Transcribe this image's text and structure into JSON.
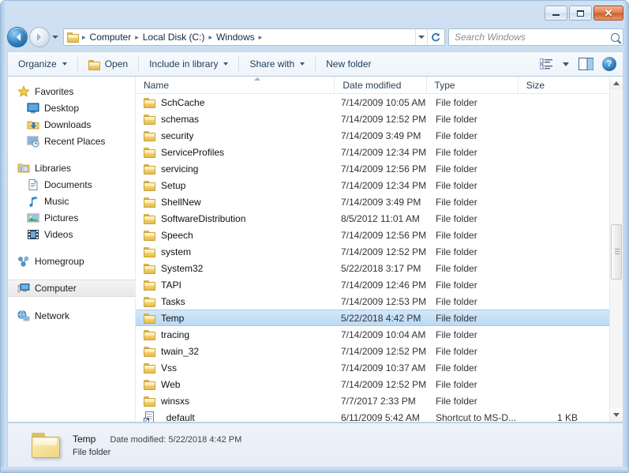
{
  "window": {
    "minimize_label": "Minimize",
    "maximize_label": "Maximize",
    "close_label": "Close"
  },
  "navigation": {
    "back_label": "Back",
    "forward_label": "Forward",
    "history_label": "Recent pages",
    "refresh_label": "Refresh",
    "breadcrumbs": [
      "Computer",
      "Local Disk (C:)",
      "Windows"
    ],
    "separator": "▸"
  },
  "search": {
    "placeholder": "Search Windows"
  },
  "toolbar": {
    "organize_label": "Organize",
    "open_label": "Open",
    "include_label": "Include in library",
    "share_label": "Share with",
    "newfolder_label": "New folder",
    "views_label": "Change your view",
    "preview_label": "Show the preview pane",
    "help_label": "?"
  },
  "sidebar": {
    "groups": [
      {
        "header": "Favorites",
        "icon": "star-icon",
        "items": [
          {
            "label": "Desktop",
            "icon": "desktop-icon"
          },
          {
            "label": "Downloads",
            "icon": "downloads-icon"
          },
          {
            "label": "Recent Places",
            "icon": "recent-places-icon"
          }
        ]
      },
      {
        "header": "Libraries",
        "icon": "libraries-icon",
        "items": [
          {
            "label": "Documents",
            "icon": "documents-icon"
          },
          {
            "label": "Music",
            "icon": "music-icon"
          },
          {
            "label": "Pictures",
            "icon": "pictures-icon"
          },
          {
            "label": "Videos",
            "icon": "videos-icon"
          }
        ]
      },
      {
        "header": "Homegroup",
        "icon": "homegroup-icon",
        "items": []
      },
      {
        "header": "Computer",
        "icon": "computer-icon",
        "items": [],
        "selected": true
      },
      {
        "header": "Network",
        "icon": "network-icon",
        "items": []
      }
    ]
  },
  "filelist": {
    "columns": [
      "Name",
      "Date modified",
      "Type",
      "Size"
    ],
    "sorted_column": "Name",
    "rows": [
      {
        "name": "SchCache",
        "date": "7/14/2009 10:05 AM",
        "type": "File folder",
        "size": "",
        "icon": "folder-icon"
      },
      {
        "name": "schemas",
        "date": "7/14/2009 12:52 PM",
        "type": "File folder",
        "size": "",
        "icon": "folder-icon"
      },
      {
        "name": "security",
        "date": "7/14/2009 3:49 PM",
        "type": "File folder",
        "size": "",
        "icon": "folder-icon"
      },
      {
        "name": "ServiceProfiles",
        "date": "7/14/2009 12:34 PM",
        "type": "File folder",
        "size": "",
        "icon": "folder-icon"
      },
      {
        "name": "servicing",
        "date": "7/14/2009 12:56 PM",
        "type": "File folder",
        "size": "",
        "icon": "folder-icon"
      },
      {
        "name": "Setup",
        "date": "7/14/2009 12:34 PM",
        "type": "File folder",
        "size": "",
        "icon": "folder-icon"
      },
      {
        "name": "ShellNew",
        "date": "7/14/2009 3:49 PM",
        "type": "File folder",
        "size": "",
        "icon": "folder-icon"
      },
      {
        "name": "SoftwareDistribution",
        "date": "8/5/2012 11:01 AM",
        "type": "File folder",
        "size": "",
        "icon": "folder-icon"
      },
      {
        "name": "Speech",
        "date": "7/14/2009 12:56 PM",
        "type": "File folder",
        "size": "",
        "icon": "folder-icon"
      },
      {
        "name": "system",
        "date": "7/14/2009 12:52 PM",
        "type": "File folder",
        "size": "",
        "icon": "folder-icon"
      },
      {
        "name": "System32",
        "date": "5/22/2018 3:17 PM",
        "type": "File folder",
        "size": "",
        "icon": "folder-icon"
      },
      {
        "name": "TAPI",
        "date": "7/14/2009 12:46 PM",
        "type": "File folder",
        "size": "",
        "icon": "folder-icon"
      },
      {
        "name": "Tasks",
        "date": "7/14/2009 12:53 PM",
        "type": "File folder",
        "size": "",
        "icon": "folder-icon"
      },
      {
        "name": "Temp",
        "date": "5/22/2018 4:42 PM",
        "type": "File folder",
        "size": "",
        "icon": "folder-icon",
        "selected": true
      },
      {
        "name": "tracing",
        "date": "7/14/2009 10:04 AM",
        "type": "File folder",
        "size": "",
        "icon": "folder-icon"
      },
      {
        "name": "twain_32",
        "date": "7/14/2009 12:52 PM",
        "type": "File folder",
        "size": "",
        "icon": "folder-icon"
      },
      {
        "name": "Vss",
        "date": "7/14/2009 10:37 AM",
        "type": "File folder",
        "size": "",
        "icon": "folder-icon"
      },
      {
        "name": "Web",
        "date": "7/14/2009 12:52 PM",
        "type": "File folder",
        "size": "",
        "icon": "folder-icon"
      },
      {
        "name": "winsxs",
        "date": "7/7/2017 2:33 PM",
        "type": "File folder",
        "size": "",
        "icon": "folder-icon"
      },
      {
        "name": "_default",
        "date": "6/11/2009 5:42 AM",
        "type": "Shortcut to MS-D...",
        "size": "1 KB",
        "icon": "shortcut-icon"
      }
    ]
  },
  "details_pane": {
    "icon": "folder-icon-large",
    "name": "Temp",
    "kind": "File folder",
    "date_label": "Date modified:",
    "date_value": "5/22/2018 4:42 PM"
  },
  "colors": {
    "frame": "#c3d8ee",
    "selection": "#b9d9f4",
    "folder": "#f4d271",
    "accent": "#2f7fc0"
  }
}
